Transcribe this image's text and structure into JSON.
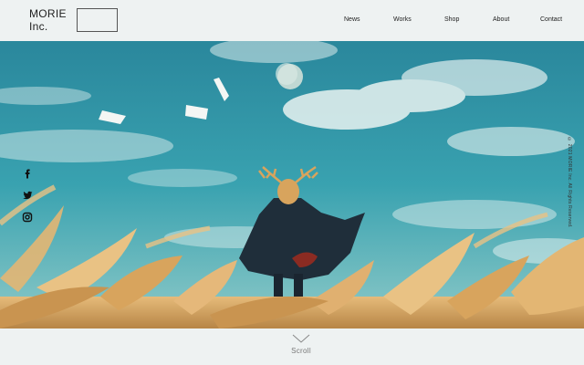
{
  "brand": {
    "line1": "MORIE",
    "line2": "Inc."
  },
  "nav": [
    {
      "label": "News"
    },
    {
      "label": "Works"
    },
    {
      "label": "Shop"
    },
    {
      "label": "About"
    },
    {
      "label": "Contact"
    }
  ],
  "social": [
    {
      "glyph": "f",
      "icon": "facebook-icon"
    },
    {
      "glyph": "twitter",
      "icon": "twitter-icon"
    },
    {
      "glyph": "instagram",
      "icon": "instagram-icon"
    }
  ],
  "copyright": "© 2021 MORIE Inc. All Rights Reserved.",
  "scroll": {
    "label": "Scroll"
  },
  "colors": {
    "background": "#eef2f2",
    "sky": "#2f8ea1",
    "grass": "#d9a868",
    "cloak": "#1f2e3a"
  }
}
